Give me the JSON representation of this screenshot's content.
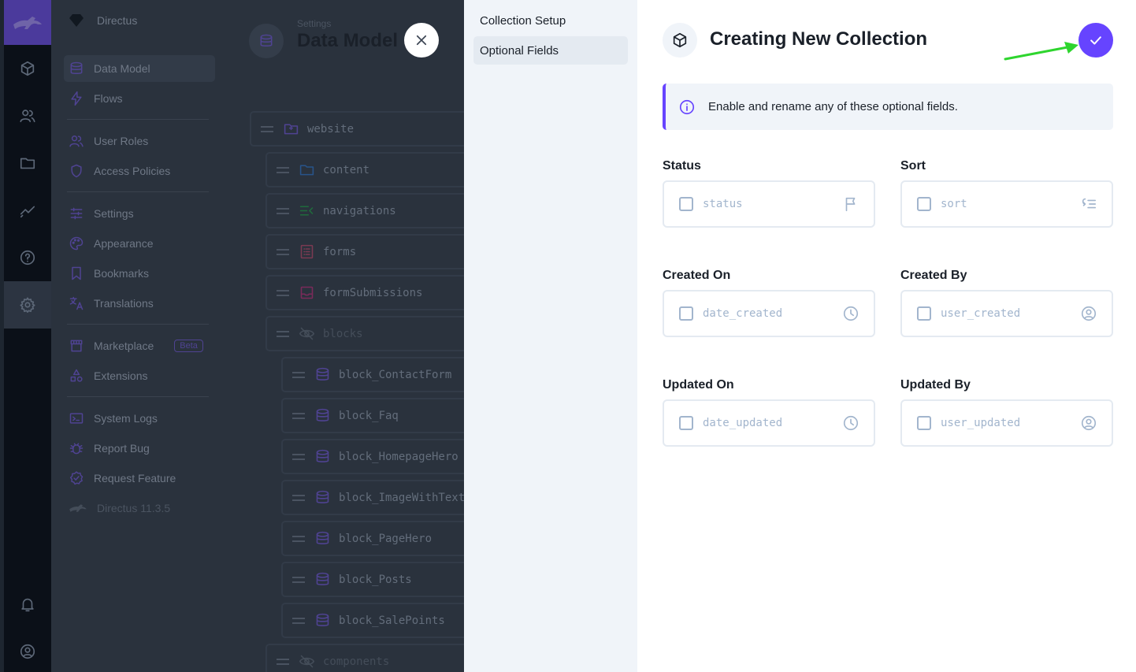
{
  "app": {
    "project_name": "Directus",
    "version": "Directus 11.3.5"
  },
  "nav": {
    "items": [
      {
        "label": "Data Model",
        "icon": "database-icon"
      },
      {
        "label": "Flows",
        "icon": "bolt-icon"
      },
      {
        "label": "User Roles",
        "icon": "users-icon"
      },
      {
        "label": "Access Policies",
        "icon": "shield-icon"
      },
      {
        "label": "Settings",
        "icon": "sliders-icon"
      },
      {
        "label": "Appearance",
        "icon": "palette-icon"
      },
      {
        "label": "Bookmarks",
        "icon": "bookmark-icon"
      },
      {
        "label": "Translations",
        "icon": "translate-icon"
      },
      {
        "label": "Marketplace",
        "icon": "store-icon",
        "badge": "Beta"
      },
      {
        "label": "Extensions",
        "icon": "shapes-icon"
      },
      {
        "label": "System Logs",
        "icon": "terminal-icon"
      },
      {
        "label": "Report Bug",
        "icon": "bug-icon"
      },
      {
        "label": "Request Feature",
        "icon": "check-badge-icon"
      }
    ]
  },
  "header": {
    "breadcrumb": "Settings",
    "title": "Data Model"
  },
  "collections": [
    {
      "name": "website",
      "icon": "folder-icon"
    },
    {
      "name": "content",
      "icon": "folder-icon"
    },
    {
      "name": "navigations",
      "icon": "menu-icon"
    },
    {
      "name": "forms",
      "icon": "list-icon"
    },
    {
      "name": "formSubmissions",
      "icon": "inbox-icon"
    },
    {
      "name": "blocks",
      "icon": "eye-off-icon"
    },
    {
      "name": "block_ContactForm",
      "icon": "database-icon"
    },
    {
      "name": "block_Faq",
      "icon": "database-icon"
    },
    {
      "name": "block_HomepageHero",
      "icon": "database-icon"
    },
    {
      "name": "block_ImageWithText",
      "icon": "database-icon"
    },
    {
      "name": "block_PageHero",
      "icon": "database-icon"
    },
    {
      "name": "block_Posts",
      "icon": "database-icon"
    },
    {
      "name": "block_SalePoints",
      "icon": "database-icon"
    },
    {
      "name": "components",
      "icon": "eye-off-icon"
    }
  ],
  "drawer": {
    "nav": [
      "Collection Setup",
      "Optional Fields"
    ],
    "title": "Creating New Collection",
    "notice": "Enable and rename any of these optional fields.",
    "fields": [
      {
        "label": "Status",
        "placeholder": "status",
        "icon": "flag-icon"
      },
      {
        "label": "Sort",
        "placeholder": "sort",
        "icon": "sort-icon"
      },
      {
        "label": "Created On",
        "placeholder": "date_created",
        "icon": "clock-icon"
      },
      {
        "label": "Created By",
        "placeholder": "user_created",
        "icon": "user-circle-icon"
      },
      {
        "label": "Updated On",
        "placeholder": "date_updated",
        "icon": "clock-icon"
      },
      {
        "label": "Updated By",
        "placeholder": "user_updated",
        "icon": "user-circle-icon"
      }
    ]
  },
  "colors": {
    "accent": "#6644ff",
    "annotation_arrow": "#2ed52e"
  }
}
